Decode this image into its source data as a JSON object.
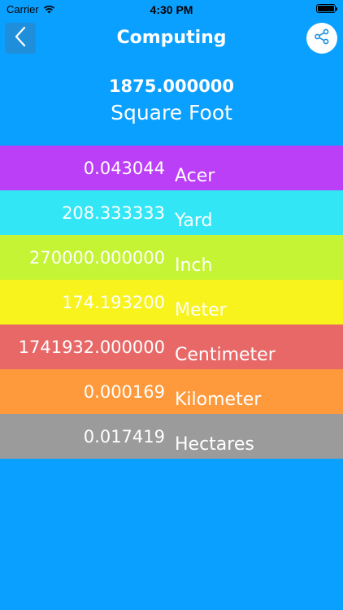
{
  "status_bar": {
    "carrier": "Carrier",
    "time": "4:30 PM"
  },
  "header": {
    "title": "Computing",
    "back_icon": "chevron-left-icon",
    "share_icon": "share-icon"
  },
  "input": {
    "value": "1875.000000",
    "unit": "Square Foot"
  },
  "results": [
    {
      "value": "0.043044",
      "unit": "Acer",
      "color": "#bb3ff7"
    },
    {
      "value": "208.333333",
      "unit": "Yard",
      "color": "#33e6f6"
    },
    {
      "value": "270000.000000",
      "unit": "Inch",
      "color": "#c4f434"
    },
    {
      "value": "174.193200",
      "unit": "Meter",
      "color": "#f8f21d"
    },
    {
      "value": "1741932.000000",
      "unit": "Centimeter",
      "color": "#e86868"
    },
    {
      "value": "0.000169",
      "unit": "Kilometer",
      "color": "#ff9a3c"
    },
    {
      "value": "0.017419",
      "unit": "Hectares",
      "color": "#9b9b9b"
    }
  ],
  "colors": {
    "background": "#0aa0ff",
    "back_button": "#1f8fdc"
  }
}
